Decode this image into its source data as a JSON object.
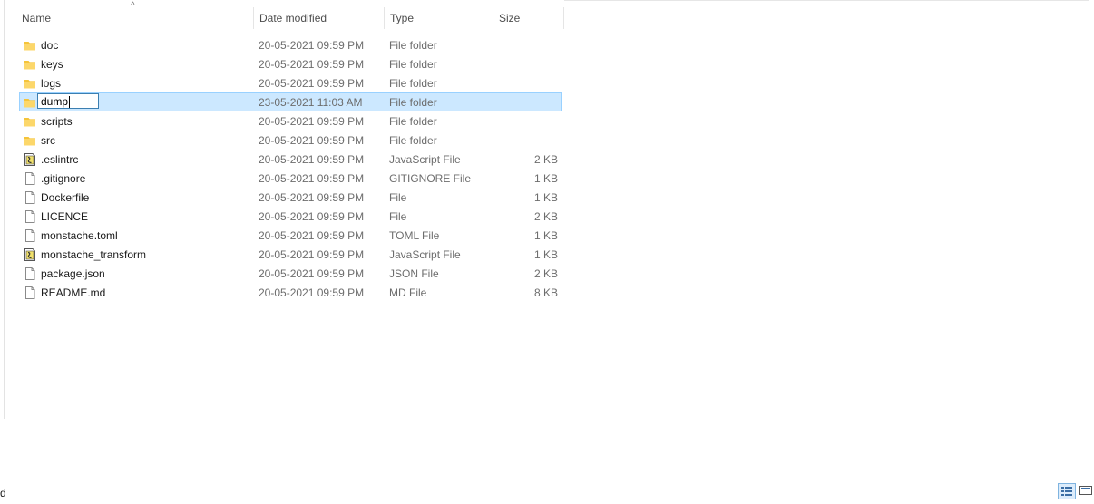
{
  "columns": {
    "name": "Name",
    "date": "Date modified",
    "type": "Type",
    "size": "Size"
  },
  "sort_indicator": "^",
  "left_edge_text": "d",
  "rename": {
    "value": "dump"
  },
  "colors": {
    "selection_bg": "#cce8ff",
    "selection_border": "#99d1ff",
    "folder_yellow": "#f5c43a",
    "edit_border": "#3c7fb1"
  },
  "files": [
    {
      "name": "doc",
      "date": "20-05-2021 09:59 PM",
      "type": "File folder",
      "size": "",
      "icon": "folder-icon"
    },
    {
      "name": "keys",
      "date": "20-05-2021 09:59 PM",
      "type": "File folder",
      "size": "",
      "icon": "folder-icon"
    },
    {
      "name": "logs",
      "date": "20-05-2021 09:59 PM",
      "type": "File folder",
      "size": "",
      "icon": "folder-icon"
    },
    {
      "name": "dump",
      "date": "23-05-2021 11:03 AM",
      "type": "File folder",
      "size": "",
      "icon": "folder-icon",
      "selected": true,
      "renaming": true
    },
    {
      "name": "scripts",
      "date": "20-05-2021 09:59 PM",
      "type": "File folder",
      "size": "",
      "icon": "folder-icon"
    },
    {
      "name": "src",
      "date": "20-05-2021 09:59 PM",
      "type": "File folder",
      "size": "",
      "icon": "folder-icon"
    },
    {
      "name": ".eslintrc",
      "date": "20-05-2021 09:59 PM",
      "type": "JavaScript File",
      "size": "2 KB",
      "icon": "javascript-file-icon"
    },
    {
      "name": ".gitignore",
      "date": "20-05-2021 09:59 PM",
      "type": "GITIGNORE File",
      "size": "1 KB",
      "icon": "file-icon"
    },
    {
      "name": "Dockerfile",
      "date": "20-05-2021 09:59 PM",
      "type": "File",
      "size": "1 KB",
      "icon": "file-icon"
    },
    {
      "name": "LICENCE",
      "date": "20-05-2021 09:59 PM",
      "type": "File",
      "size": "2 KB",
      "icon": "file-icon"
    },
    {
      "name": "monstache.toml",
      "date": "20-05-2021 09:59 PM",
      "type": "TOML File",
      "size": "1 KB",
      "icon": "file-icon"
    },
    {
      "name": "monstache_transform",
      "date": "20-05-2021 09:59 PM",
      "type": "JavaScript File",
      "size": "1 KB",
      "icon": "javascript-file-icon"
    },
    {
      "name": "package.json",
      "date": "20-05-2021 09:59 PM",
      "type": "JSON File",
      "size": "2 KB",
      "icon": "file-icon"
    },
    {
      "name": "README.md",
      "date": "20-05-2021 09:59 PM",
      "type": "MD File",
      "size": "8 KB",
      "icon": "file-icon"
    }
  ],
  "view_toggles": [
    {
      "icon": "details-view-icon",
      "active": true
    },
    {
      "icon": "large-icons-view-icon",
      "active": false
    }
  ]
}
